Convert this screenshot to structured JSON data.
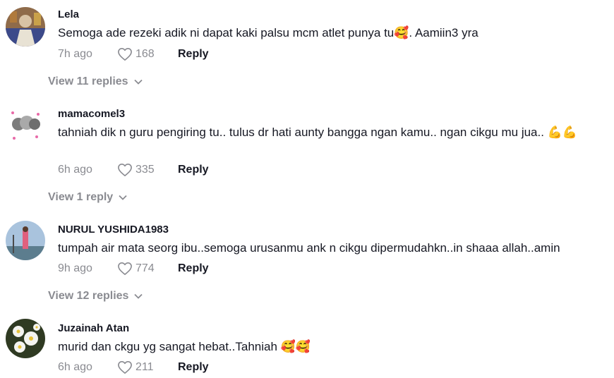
{
  "comments": [
    {
      "username": "Lela",
      "text": "Semoga ade rezeki adik ni dapat kaki palsu mcm atlet punya tu🥰. Aamiin3 yra",
      "time": "7h ago",
      "likes": "168",
      "reply_label": "Reply",
      "view_replies": "View 11 replies"
    },
    {
      "username": "mamacomel3",
      "text": "tahniah dik n guru pengiring tu.. tulus dr hati aunty bangga ngan kamu.. ngan cikgu mu jua.. 💪💪",
      "time": "6h ago",
      "likes": "335",
      "reply_label": "Reply",
      "view_replies": "View 1 reply"
    },
    {
      "username": "NURUL YUSHIDA1983",
      "text": "tumpah air mata seorg ibu..semoga urusanmu ank n cikgu dipermudahkn..in shaaa allah..amin",
      "time": "9h ago",
      "likes": "774",
      "reply_label": "Reply",
      "view_replies": "View 12 replies"
    },
    {
      "username": "Juzainah Atan",
      "text": "murid dan ckgu yg sangat hebat..Tahniah 🥰🥰",
      "time": "6h ago",
      "likes": "211",
      "reply_label": "Reply"
    }
  ],
  "icons": {
    "like": "heart-outline-icon",
    "expand": "chevron-down-icon"
  },
  "colors": {
    "text": "#161823",
    "muted": "#8a8b91"
  }
}
